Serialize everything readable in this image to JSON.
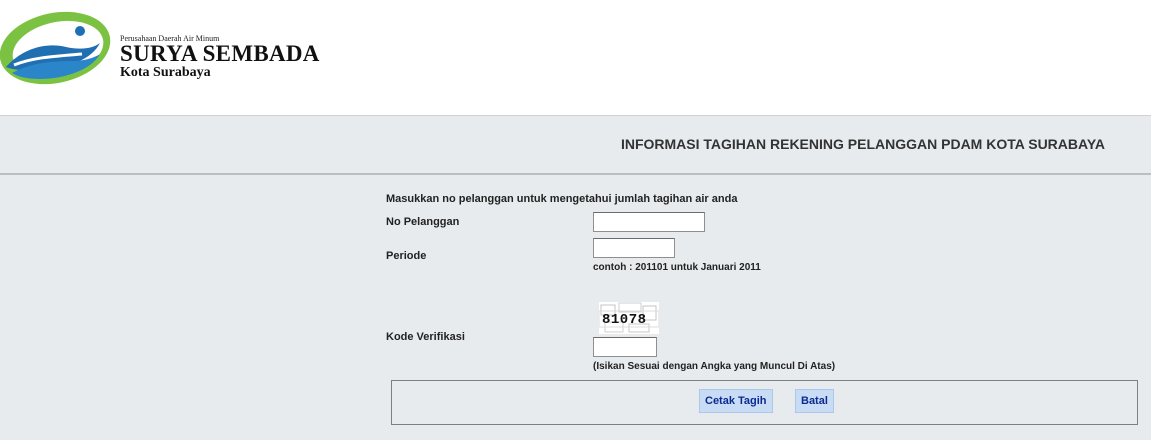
{
  "header": {
    "org_line": "Perusahaan Daerah Air Minum",
    "brand": "SURYA SEMBADA",
    "city": "Kota Surabaya"
  },
  "page_title": "INFORMASI TAGIHAN REKENING PELANGGAN PDAM KOTA SURABAYA",
  "form": {
    "instruction": "Masukkan no pelanggan untuk mengetahui jumlah tagihan air anda",
    "customer_label": "No Pelanggan",
    "customer_value": "",
    "period_label": "Periode",
    "period_value": "",
    "period_hint": "contoh : 201101 untuk Januari 2011",
    "verify_label": "Kode Verifikasi",
    "captcha_code": "81078",
    "verify_value": "",
    "verify_hint": "(Isikan Sesuai dengan Angka yang Muncul Di Atas)"
  },
  "buttons": {
    "print": "Cetak Tagih",
    "cancel": "Batal"
  },
  "colors": {
    "logo_green": "#7cc242",
    "logo_blue": "#1f6fb2",
    "button_bg": "#c9dcf5",
    "button_text": "#0b2a8f"
  }
}
